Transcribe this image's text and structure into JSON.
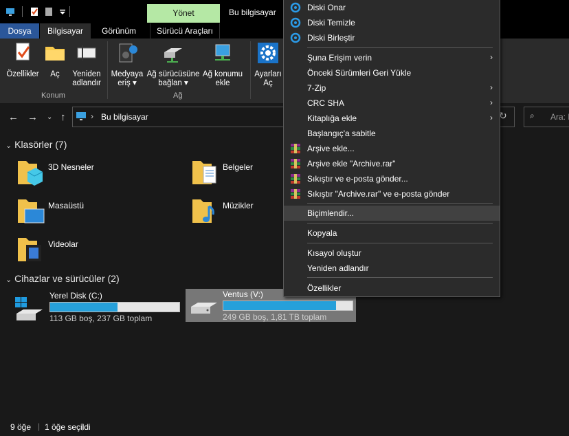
{
  "window": {
    "title": "Bu bilgisayar",
    "context_tab": "Yönet"
  },
  "tabs": [
    "Dosya",
    "Bilgisayar",
    "Görünüm",
    "Sürücü Araçları"
  ],
  "ribbon": {
    "buttons": [
      {
        "label": "Özellikler",
        "icon": "properties-icon"
      },
      {
        "label": "Aç",
        "icon": "open-folder-icon"
      },
      {
        "label": "Yeniden\nadlandır",
        "icon": "rename-icon"
      },
      {
        "label": "Medyaya\neriş ▾",
        "icon": "media-access-icon"
      },
      {
        "label": "Ağ sürücüsüne\nbağlan ▾",
        "icon": "map-network-drive-icon"
      },
      {
        "label": "Ağ konumu\nekle",
        "icon": "network-location-icon"
      },
      {
        "label": "Ayarları\nAç",
        "icon": "settings-gear-icon"
      }
    ],
    "groups": [
      "Konum",
      "Ağ"
    ]
  },
  "address": {
    "path": "Bu bilgisayar",
    "search_placeholder": "Ara: Bu"
  },
  "folders": {
    "header": "Klasörler (7)",
    "items": [
      "3D Nesneler",
      "Belgeler",
      "Masaüstü",
      "Müzikler",
      "Videolar"
    ]
  },
  "drives": {
    "header": "Cihazlar ve sürücüler (2)",
    "items": [
      {
        "name": "Yerel Disk (C:)",
        "info": "113 GB boş, 237 GB toplam",
        "used_fraction": 0.52
      },
      {
        "name": "Ventus (V:)",
        "info": "249 GB boş, 1,81 TB toplam",
        "used_fraction": 0.87
      }
    ]
  },
  "status": {
    "count": "9 öğe",
    "selected": "1 öğe seçildi"
  },
  "context_menu": {
    "items": [
      "Diski Onar",
      "Diski Temizle",
      "Diski Birleştir",
      "Şuna Erişim verin",
      "Önceki Sürümleri Geri Yükle",
      "7-Zip",
      "CRC SHA",
      "Kitaplığa ekle",
      "Başlangıç'a sabitle",
      "Arşive ekle...",
      "Arşive ekle \"Archive.rar\"",
      "Sıkıştır ve e-posta gönder...",
      "Sıkıştır \"Archive.rar\" ve e-posta gönder",
      "Biçimlendir...",
      "Kopyala",
      "Kısayol oluştur",
      "Yeniden adlandır",
      "Özellikler"
    ],
    "arrow": "›"
  },
  "colors": {
    "accent": "#2b579a",
    "manage_tab": "#b5e8a5",
    "drive_bar": "#26a0da"
  }
}
